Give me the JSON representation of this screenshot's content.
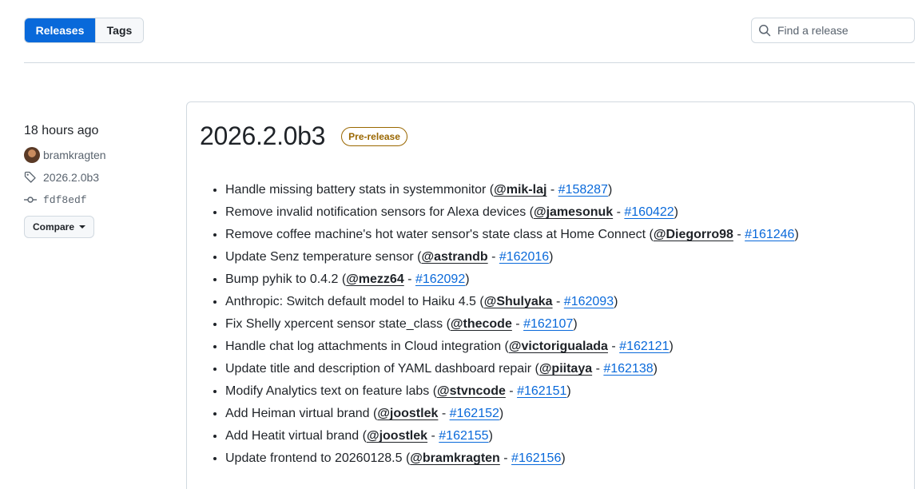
{
  "tabs": {
    "releases_label": "Releases",
    "tags_label": "Tags"
  },
  "search": {
    "placeholder": "Find a release"
  },
  "release": {
    "relative_time": "18 hours ago",
    "author": "bramkragten",
    "tag": "2026.2.0b3",
    "commit": "fdf8edf",
    "compare_label": "Compare",
    "title": "2026.2.0b3",
    "badge": "Pre-release",
    "notes": [
      {
        "text": "Handle missing battery stats in systemmonitor (",
        "user": "@mik-laj",
        "sep": " - ",
        "pr": "#158287",
        "end": ")"
      },
      {
        "text": "Remove invalid notification sensors for Alexa devices (",
        "user": "@jamesonuk",
        "sep": " - ",
        "pr": "#160422",
        "end": ")"
      },
      {
        "text": "Remove coffee machine's hot water sensor's state class at Home Connect (",
        "user": "@Diegorro98",
        "sep": " - ",
        "pr": "#161246",
        "end": ")"
      },
      {
        "text": "Update Senz temperature sensor (",
        "user": "@astrandb",
        "sep": " - ",
        "pr": "#162016",
        "end": ")"
      },
      {
        "text": "Bump pyhik to 0.4.2 (",
        "user": "@mezz64",
        "sep": " - ",
        "pr": "#162092",
        "end": ")"
      },
      {
        "text": "Anthropic: Switch default model to Haiku 4.5 (",
        "user": "@Shulyaka",
        "sep": " - ",
        "pr": "#162093",
        "end": ")"
      },
      {
        "text": "Fix Shelly xpercent sensor state_class (",
        "user": "@thecode",
        "sep": " - ",
        "pr": "#162107",
        "end": ")"
      },
      {
        "text": "Handle chat log attachments in Cloud integration (",
        "user": "@victorigualada",
        "sep": " - ",
        "pr": "#162121",
        "end": ")"
      },
      {
        "text": "Update title and description of YAML dashboard repair (",
        "user": "@piitaya",
        "sep": " - ",
        "pr": "#162138",
        "end": ")"
      },
      {
        "text": "Modify Analytics text on feature labs (",
        "user": "@stvncode",
        "sep": " - ",
        "pr": "#162151",
        "end": ")"
      },
      {
        "text": "Add Heiman virtual brand (",
        "user": "@joostlek",
        "sep": " - ",
        "pr": "#162152",
        "end": ")"
      },
      {
        "text": "Add Heatit virtual brand (",
        "user": "@joostlek",
        "sep": " - ",
        "pr": "#162155",
        "end": ")"
      },
      {
        "text": "Update frontend to 20260128.5 (",
        "user": "@bramkragten",
        "sep": " - ",
        "pr": "#162156",
        "end": ")"
      }
    ]
  },
  "colors": {
    "accent": "#0969da",
    "badge": "#9a6700",
    "border": "#d1d9e0"
  }
}
